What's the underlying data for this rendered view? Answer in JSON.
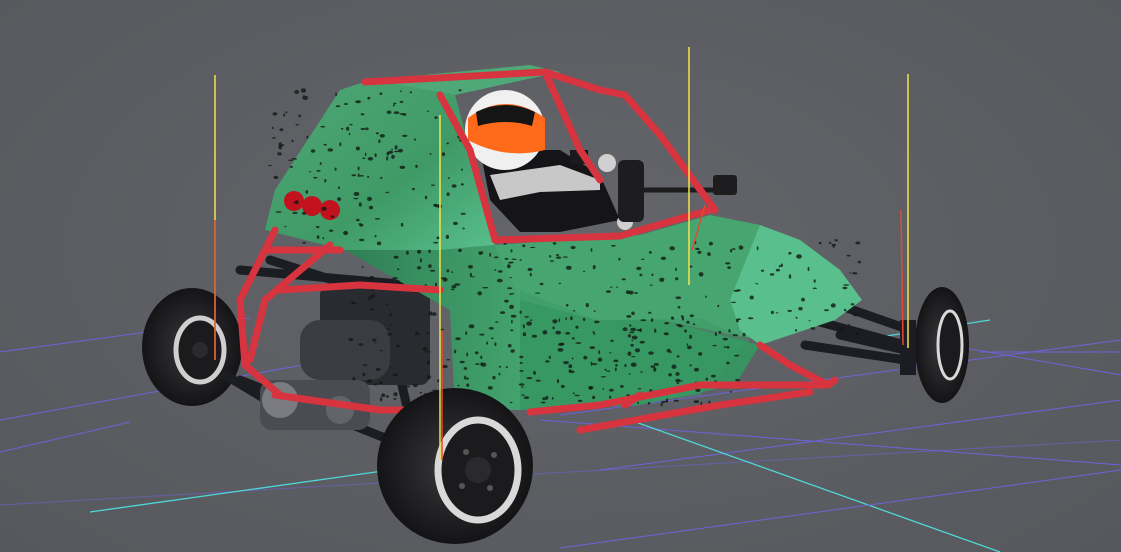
{
  "viewport": {
    "background_color": "#5d5f64",
    "grid_color": "#6d63d8",
    "grid_axis_color": "#4fd7d6"
  },
  "vehicle": {
    "body_color": "#3e9a63",
    "body_highlight": "#57c08a",
    "speckle_color": "#121a14",
    "roll_cage_color": "#d8343f",
    "tire_color": "#262628",
    "rim_color": "#d9d9d9",
    "tail_light_color": "#c2121e",
    "helmet_colors": [
      "#e0e0e0",
      "#ff6a1a",
      "#151515"
    ]
  },
  "gizmos": {
    "line_color": "#f2e34a",
    "marker_color": "#e04a35"
  }
}
